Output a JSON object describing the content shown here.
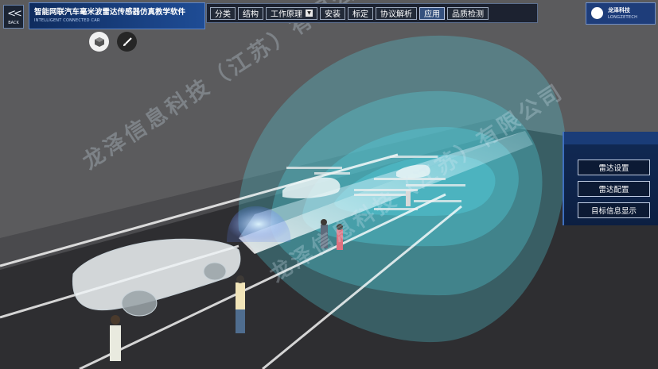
{
  "header": {
    "back_label": "BACK",
    "title": "智能网联汽车毫米波雷达传感器仿真教学软件",
    "subtitle": "INTELLIGENT CONNECTED CAR"
  },
  "menu": {
    "items": [
      "分类",
      "结构",
      "工作原理",
      "安装",
      "标定",
      "协议解析",
      "应用",
      "品质检测"
    ],
    "active_index": 6,
    "dropdown_index": 2
  },
  "logo": {
    "cn": "龙泽科技",
    "en": "LONGZETECH"
  },
  "toolbar": {
    "view_icon": "cube-icon",
    "brush_icon": "brush-icon"
  },
  "side_panel": {
    "buttons": [
      "雷达设置",
      "雷达配置",
      "目标信息显示"
    ]
  },
  "watermark": {
    "line1": "龙泽信息科技（江苏）有限公司",
    "line2": "龙泽信息科技（江苏）有限公司"
  },
  "colors": {
    "radar_cyan": "#5fe3ee",
    "road": "#2c2c2e",
    "panel_blue": "#112a55"
  }
}
